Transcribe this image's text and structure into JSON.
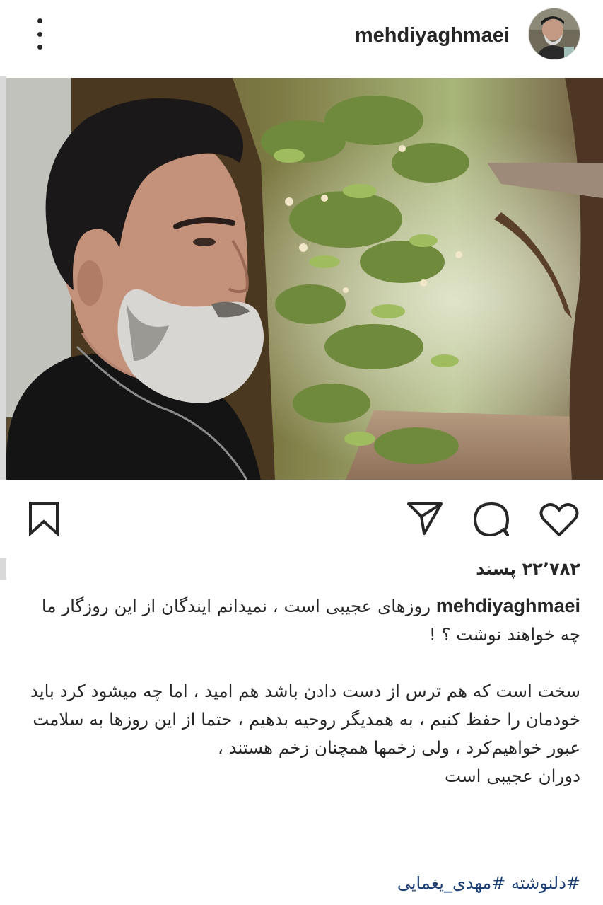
{
  "header": {
    "username": "mehdiyaghmaei",
    "menu_icon": "more-vertical-icon"
  },
  "post": {
    "likes_count": "۲۲٬۷۸۲",
    "likes_word": "پسند"
  },
  "actions": {
    "like_icon": "heart-icon",
    "comment_icon": "comment-icon",
    "share_icon": "send-icon",
    "save_icon": "bookmark-icon"
  },
  "caption": {
    "username": "mehdiyaghmaei",
    "line1": "روزهای عجیبی است ، نمیدانم ایندگان از این روزگار ما چه خواهند نوشت ؟ !",
    "line2": "سخت است که هم ترس از دست دادن باشد هم امید ، اما چه میشود کرد باید خودمان را حفظ کنیم ، به همدیگر روحیه بدهیم ، حتما از این روزها به سلامت عبور خواهیم‌کرد ، ولی زخمها همچنان زخم هستند ،",
    "line3": "دوران عجیبی است"
  },
  "hashtags": {
    "tag1": "#دلنوشته",
    "tag2": "#مهدی_یغمایی"
  },
  "colors": {
    "text": "#262626",
    "hashtag": "#1d3f73",
    "background": "#ffffff"
  }
}
